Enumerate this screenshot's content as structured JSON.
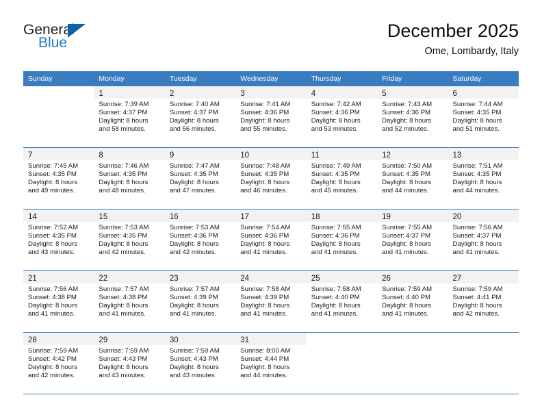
{
  "brand": {
    "name_part1": "General",
    "name_part2": "Blue",
    "logo_icon": "triangle-icon",
    "accent_color": "#1062a8",
    "text_color": "#1f7ac4"
  },
  "header": {
    "title": "December 2025",
    "subtitle": "Ome, Lombardy, Italy"
  },
  "calendar": {
    "header_bg": "#3a7cc0",
    "header_text_color": "#ffffff",
    "daynum_band_bg": "#f2f2f2",
    "weekday_headers": [
      "Sunday",
      "Monday",
      "Tuesday",
      "Wednesday",
      "Thursday",
      "Friday",
      "Saturday"
    ],
    "weeks": [
      [
        {
          "day": "",
          "sunrise": "",
          "sunset": "",
          "daylight_line1": "",
          "daylight_line2": ""
        },
        {
          "day": "1",
          "sunrise": "Sunrise: 7:39 AM",
          "sunset": "Sunset: 4:37 PM",
          "daylight_line1": "Daylight: 8 hours",
          "daylight_line2": "and 58 minutes."
        },
        {
          "day": "2",
          "sunrise": "Sunrise: 7:40 AM",
          "sunset": "Sunset: 4:37 PM",
          "daylight_line1": "Daylight: 8 hours",
          "daylight_line2": "and 56 minutes."
        },
        {
          "day": "3",
          "sunrise": "Sunrise: 7:41 AM",
          "sunset": "Sunset: 4:36 PM",
          "daylight_line1": "Daylight: 8 hours",
          "daylight_line2": "and 55 minutes."
        },
        {
          "day": "4",
          "sunrise": "Sunrise: 7:42 AM",
          "sunset": "Sunset: 4:36 PM",
          "daylight_line1": "Daylight: 8 hours",
          "daylight_line2": "and 53 minutes."
        },
        {
          "day": "5",
          "sunrise": "Sunrise: 7:43 AM",
          "sunset": "Sunset: 4:36 PM",
          "daylight_line1": "Daylight: 8 hours",
          "daylight_line2": "and 52 minutes."
        },
        {
          "day": "6",
          "sunrise": "Sunrise: 7:44 AM",
          "sunset": "Sunset: 4:35 PM",
          "daylight_line1": "Daylight: 8 hours",
          "daylight_line2": "and 51 minutes."
        }
      ],
      [
        {
          "day": "7",
          "sunrise": "Sunrise: 7:45 AM",
          "sunset": "Sunset: 4:35 PM",
          "daylight_line1": "Daylight: 8 hours",
          "daylight_line2": "and 49 minutes."
        },
        {
          "day": "8",
          "sunrise": "Sunrise: 7:46 AM",
          "sunset": "Sunset: 4:35 PM",
          "daylight_line1": "Daylight: 8 hours",
          "daylight_line2": "and 48 minutes."
        },
        {
          "day": "9",
          "sunrise": "Sunrise: 7:47 AM",
          "sunset": "Sunset: 4:35 PM",
          "daylight_line1": "Daylight: 8 hours",
          "daylight_line2": "and 47 minutes."
        },
        {
          "day": "10",
          "sunrise": "Sunrise: 7:48 AM",
          "sunset": "Sunset: 4:35 PM",
          "daylight_line1": "Daylight: 8 hours",
          "daylight_line2": "and 46 minutes."
        },
        {
          "day": "11",
          "sunrise": "Sunrise: 7:49 AM",
          "sunset": "Sunset: 4:35 PM",
          "daylight_line1": "Daylight: 8 hours",
          "daylight_line2": "and 45 minutes."
        },
        {
          "day": "12",
          "sunrise": "Sunrise: 7:50 AM",
          "sunset": "Sunset: 4:35 PM",
          "daylight_line1": "Daylight: 8 hours",
          "daylight_line2": "and 44 minutes."
        },
        {
          "day": "13",
          "sunrise": "Sunrise: 7:51 AM",
          "sunset": "Sunset: 4:35 PM",
          "daylight_line1": "Daylight: 8 hours",
          "daylight_line2": "and 44 minutes."
        }
      ],
      [
        {
          "day": "14",
          "sunrise": "Sunrise: 7:52 AM",
          "sunset": "Sunset: 4:35 PM",
          "daylight_line1": "Daylight: 8 hours",
          "daylight_line2": "and 43 minutes."
        },
        {
          "day": "15",
          "sunrise": "Sunrise: 7:53 AM",
          "sunset": "Sunset: 4:35 PM",
          "daylight_line1": "Daylight: 8 hours",
          "daylight_line2": "and 42 minutes."
        },
        {
          "day": "16",
          "sunrise": "Sunrise: 7:53 AM",
          "sunset": "Sunset: 4:36 PM",
          "daylight_line1": "Daylight: 8 hours",
          "daylight_line2": "and 42 minutes."
        },
        {
          "day": "17",
          "sunrise": "Sunrise: 7:54 AM",
          "sunset": "Sunset: 4:36 PM",
          "daylight_line1": "Daylight: 8 hours",
          "daylight_line2": "and 41 minutes."
        },
        {
          "day": "18",
          "sunrise": "Sunrise: 7:55 AM",
          "sunset": "Sunset: 4:36 PM",
          "daylight_line1": "Daylight: 8 hours",
          "daylight_line2": "and 41 minutes."
        },
        {
          "day": "19",
          "sunrise": "Sunrise: 7:55 AM",
          "sunset": "Sunset: 4:37 PM",
          "daylight_line1": "Daylight: 8 hours",
          "daylight_line2": "and 41 minutes."
        },
        {
          "day": "20",
          "sunrise": "Sunrise: 7:56 AM",
          "sunset": "Sunset: 4:37 PM",
          "daylight_line1": "Daylight: 8 hours",
          "daylight_line2": "and 41 minutes."
        }
      ],
      [
        {
          "day": "21",
          "sunrise": "Sunrise: 7:56 AM",
          "sunset": "Sunset: 4:38 PM",
          "daylight_line1": "Daylight: 8 hours",
          "daylight_line2": "and 41 minutes."
        },
        {
          "day": "22",
          "sunrise": "Sunrise: 7:57 AM",
          "sunset": "Sunset: 4:38 PM",
          "daylight_line1": "Daylight: 8 hours",
          "daylight_line2": "and 41 minutes."
        },
        {
          "day": "23",
          "sunrise": "Sunrise: 7:57 AM",
          "sunset": "Sunset: 4:39 PM",
          "daylight_line1": "Daylight: 8 hours",
          "daylight_line2": "and 41 minutes."
        },
        {
          "day": "24",
          "sunrise": "Sunrise: 7:58 AM",
          "sunset": "Sunset: 4:39 PM",
          "daylight_line1": "Daylight: 8 hours",
          "daylight_line2": "and 41 minutes."
        },
        {
          "day": "25",
          "sunrise": "Sunrise: 7:58 AM",
          "sunset": "Sunset: 4:40 PM",
          "daylight_line1": "Daylight: 8 hours",
          "daylight_line2": "and 41 minutes."
        },
        {
          "day": "26",
          "sunrise": "Sunrise: 7:59 AM",
          "sunset": "Sunset: 4:40 PM",
          "daylight_line1": "Daylight: 8 hours",
          "daylight_line2": "and 41 minutes."
        },
        {
          "day": "27",
          "sunrise": "Sunrise: 7:59 AM",
          "sunset": "Sunset: 4:41 PM",
          "daylight_line1": "Daylight: 8 hours",
          "daylight_line2": "and 42 minutes."
        }
      ],
      [
        {
          "day": "28",
          "sunrise": "Sunrise: 7:59 AM",
          "sunset": "Sunset: 4:42 PM",
          "daylight_line1": "Daylight: 8 hours",
          "daylight_line2": "and 42 minutes."
        },
        {
          "day": "29",
          "sunrise": "Sunrise: 7:59 AM",
          "sunset": "Sunset: 4:43 PM",
          "daylight_line1": "Daylight: 8 hours",
          "daylight_line2": "and 43 minutes."
        },
        {
          "day": "30",
          "sunrise": "Sunrise: 7:59 AM",
          "sunset": "Sunset: 4:43 PM",
          "daylight_line1": "Daylight: 8 hours",
          "daylight_line2": "and 43 minutes."
        },
        {
          "day": "31",
          "sunrise": "Sunrise: 8:00 AM",
          "sunset": "Sunset: 4:44 PM",
          "daylight_line1": "Daylight: 8 hours",
          "daylight_line2": "and 44 minutes."
        },
        {
          "day": "",
          "sunrise": "",
          "sunset": "",
          "daylight_line1": "",
          "daylight_line2": ""
        },
        {
          "day": "",
          "sunrise": "",
          "sunset": "",
          "daylight_line1": "",
          "daylight_line2": ""
        },
        {
          "day": "",
          "sunrise": "",
          "sunset": "",
          "daylight_line1": "",
          "daylight_line2": ""
        }
      ]
    ]
  }
}
